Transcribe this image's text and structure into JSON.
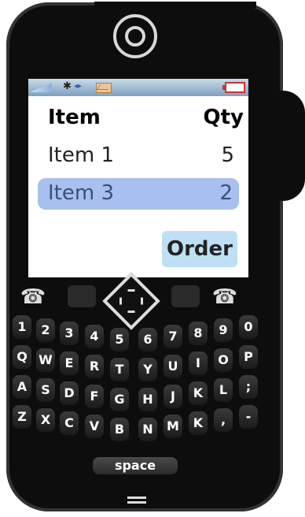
{
  "status_bar": {
    "signal_icon": "signal-icon",
    "bluetooth_glyph": "✱",
    "data_glyph": "◂▸",
    "mail_icon": "mail-icon",
    "battery_icon": "battery-icon"
  },
  "table": {
    "headers": [
      "Item",
      "Qty"
    ],
    "rows": [
      {
        "item": "Item 1",
        "qty": "5",
        "selected": false
      },
      {
        "item": "Item 3",
        "qty": "2",
        "selected": true
      }
    ]
  },
  "order_button": {
    "label": "Order"
  },
  "nav": {
    "call_glyph": "☎",
    "end_glyph": "☎"
  },
  "keyboard": {
    "row1": [
      "1",
      "2",
      "3",
      "4",
      "5",
      "6",
      "7",
      "8",
      "9",
      "0"
    ],
    "row2": [
      "Q",
      "W",
      "E",
      "R",
      "T",
      "Y",
      "U",
      "I",
      "O",
      "P"
    ],
    "row3": [
      "A",
      "S",
      "D",
      "F",
      "G",
      "H",
      "J",
      "K",
      "L",
      ";"
    ],
    "row4": [
      "Z",
      "X",
      "C",
      "V",
      "B",
      "N",
      "M",
      "K",
      ",",
      "-"
    ],
    "space_label": "space"
  },
  "colors": {
    "selected_row": "#a8c0f0",
    "order_button_bg": "#bfe0f4",
    "phone_body": "#0d0d0d"
  }
}
